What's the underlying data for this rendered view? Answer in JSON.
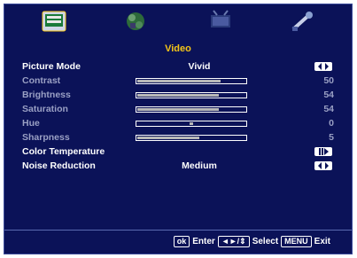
{
  "menu": {
    "tabs": [
      {
        "icon": "picture-icon",
        "selected": true
      },
      {
        "icon": "sound-icon",
        "selected": false
      },
      {
        "icon": "channel-icon",
        "selected": false
      },
      {
        "icon": "settings-icon",
        "selected": false
      }
    ],
    "section_title": "Video",
    "rows": [
      {
        "label": "Picture Mode",
        "value": "Vivid",
        "control": "arrows"
      },
      {
        "label": "Contrast",
        "value": "50",
        "level": 0.76
      },
      {
        "label": "Brightness",
        "value": "54",
        "level": 0.75
      },
      {
        "label": "Saturation",
        "value": "54",
        "level": 0.75
      },
      {
        "label": "Hue",
        "value": "0",
        "level": 0.5
      },
      {
        "label": "Sharpness",
        "value": "5",
        "level": 0.57
      },
      {
        "label": "Color Temperature",
        "control": "submenu"
      },
      {
        "label": "Noise Reduction",
        "value": "Medium",
        "control": "arrows"
      }
    ]
  },
  "footer": {
    "ok_key": "ok",
    "enter_label": "Enter",
    "nav_key": "◄►/⇕",
    "select_label": "Select",
    "menu_key": "MENU",
    "exit_label": "Exit"
  },
  "colors": {
    "background": "#0b1258",
    "accent": "#f5c518",
    "dim_text": "#9aa0c4"
  }
}
